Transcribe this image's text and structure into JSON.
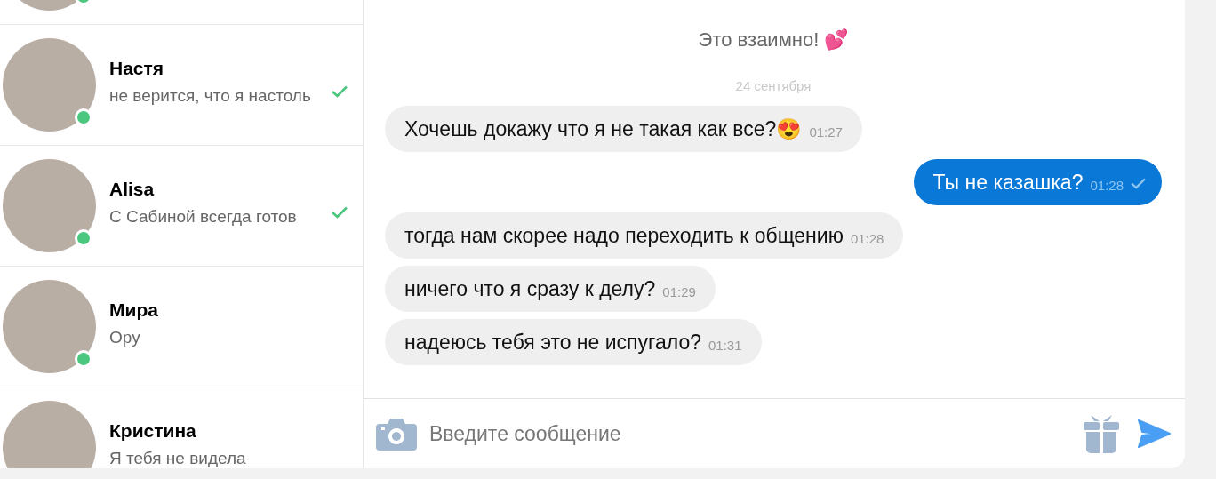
{
  "contacts": [
    {
      "online": true
    },
    {
      "name": "Настя",
      "preview": "не верится, что я настоль",
      "online": true,
      "read": true
    },
    {
      "name": "Alisa",
      "preview": "С Сабиной всегда готов",
      "online": true,
      "read": true
    },
    {
      "name": "Мира",
      "preview": "Ору",
      "online": true,
      "read": false
    },
    {
      "name": "Кристина",
      "preview": "Я тебя не видела",
      "read": false
    }
  ],
  "chat": {
    "items": [
      {
        "kind": "notice",
        "text": "Это взаимно! 💕"
      },
      {
        "kind": "date",
        "text": "24 сентября"
      },
      {
        "kind": "in",
        "text": "Хочешь докажу что я не такая как все?😍",
        "time": "01:27"
      },
      {
        "kind": "out",
        "text": "Ты не казашка?",
        "time": "01:28",
        "read": true
      },
      {
        "kind": "in",
        "text": "тогда нам скорее надо переходить к общению",
        "time": "01:28"
      },
      {
        "kind": "in",
        "text": "ничего что я сразу к делу?",
        "time": "01:29"
      },
      {
        "kind": "in",
        "text": "надеюсь тебя это не испугало?",
        "time": "01:31"
      }
    ]
  },
  "composer": {
    "placeholder": "Введите сообщение"
  }
}
